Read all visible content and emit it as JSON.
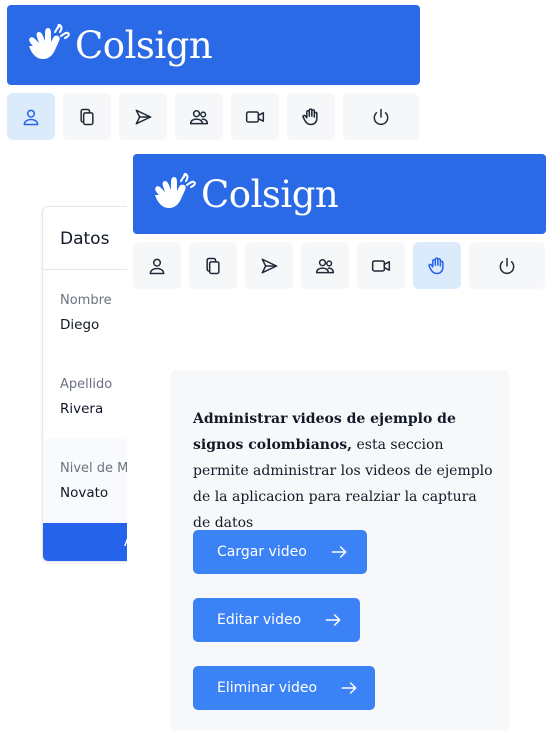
{
  "brand": "Colsign",
  "nav": {
    "items": [
      {
        "icon": "user-icon"
      },
      {
        "icon": "copy-icon"
      },
      {
        "icon": "send-icon"
      },
      {
        "icon": "users-icon"
      },
      {
        "icon": "video-icon"
      },
      {
        "icon": "hand-icon"
      },
      {
        "icon": "power-icon"
      }
    ],
    "back_active": "user-icon",
    "front_active": "hand-icon"
  },
  "profile": {
    "title": "Datos",
    "fields": [
      {
        "label": "Nombre",
        "value": "Diego"
      },
      {
        "label": "Apellido",
        "value": "Rivera"
      },
      {
        "label": "Nivel de M",
        "value": "Novato"
      }
    ],
    "button_label": "A"
  },
  "videos": {
    "heading": "Administrar videos de ejemplo de signos colombianos,",
    "body": " esta seccion permite administrar los videos de ejemplo de la aplicacion para realziar la captura de datos",
    "actions": [
      {
        "label": "Cargar video"
      },
      {
        "label": "Editar video"
      },
      {
        "label": "Eliminar video"
      }
    ]
  },
  "colors": {
    "primary": "#2b6ae6",
    "button": "#3b82f6",
    "active_nav": "#dcebfb"
  }
}
